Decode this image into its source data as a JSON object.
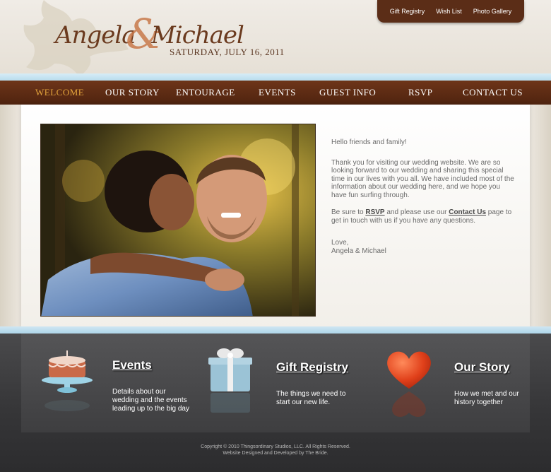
{
  "header": {
    "name_left": "Angela",
    "ampersand": "&",
    "name_right": "Michael",
    "date": "SATURDAY, JULY 16, 2011"
  },
  "top_links": [
    "Gift Registry",
    "Wish List",
    "Photo Gallery"
  ],
  "nav": {
    "items": [
      "WELCOME",
      "OUR STORY",
      "ENTOURAGE",
      "EVENTS",
      "GUEST INFO",
      "RSVP",
      "CONTACT US"
    ],
    "active": "WELCOME",
    "active_color": "#e3a43c"
  },
  "welcome": {
    "greeting": "Hello friends and family!",
    "para1": "Thank you for visiting our wedding website. We are so looking forward to our wedding and sharing this special time in our lives with you all. We have included most of the information about our wedding here, and we hope you have fun surfing through.",
    "para2_prefix": "Be sure to ",
    "rsvp_link": "RSVP",
    "para2_middle": " and please use our ",
    "contact_link": "Contact Us",
    "para2_suffix": " page to get in touch with us if you have any questions.",
    "signoff": "Love,",
    "signature": "Angela & Michael"
  },
  "features": [
    {
      "title": "Events",
      "desc": "Details about our wedding and the events leading up to the big day",
      "icon": "cake-icon"
    },
    {
      "title": "Gift Registry",
      "desc": "The things we need to start our new life.",
      "icon": "gift-box-icon"
    },
    {
      "title": "Our Story",
      "desc": "How we met and our history together",
      "icon": "heart-icon"
    }
  ],
  "footer": {
    "line1": "Copyright © 2010 Thingsordinary Studios, LLC. All Rights Reserved.",
    "line2": "Website Designed and Developed by The Bride."
  },
  "colors": {
    "brown": "#5b2d17",
    "light_blue": "#b9dced",
    "footer_gray": "#3e3e40"
  }
}
